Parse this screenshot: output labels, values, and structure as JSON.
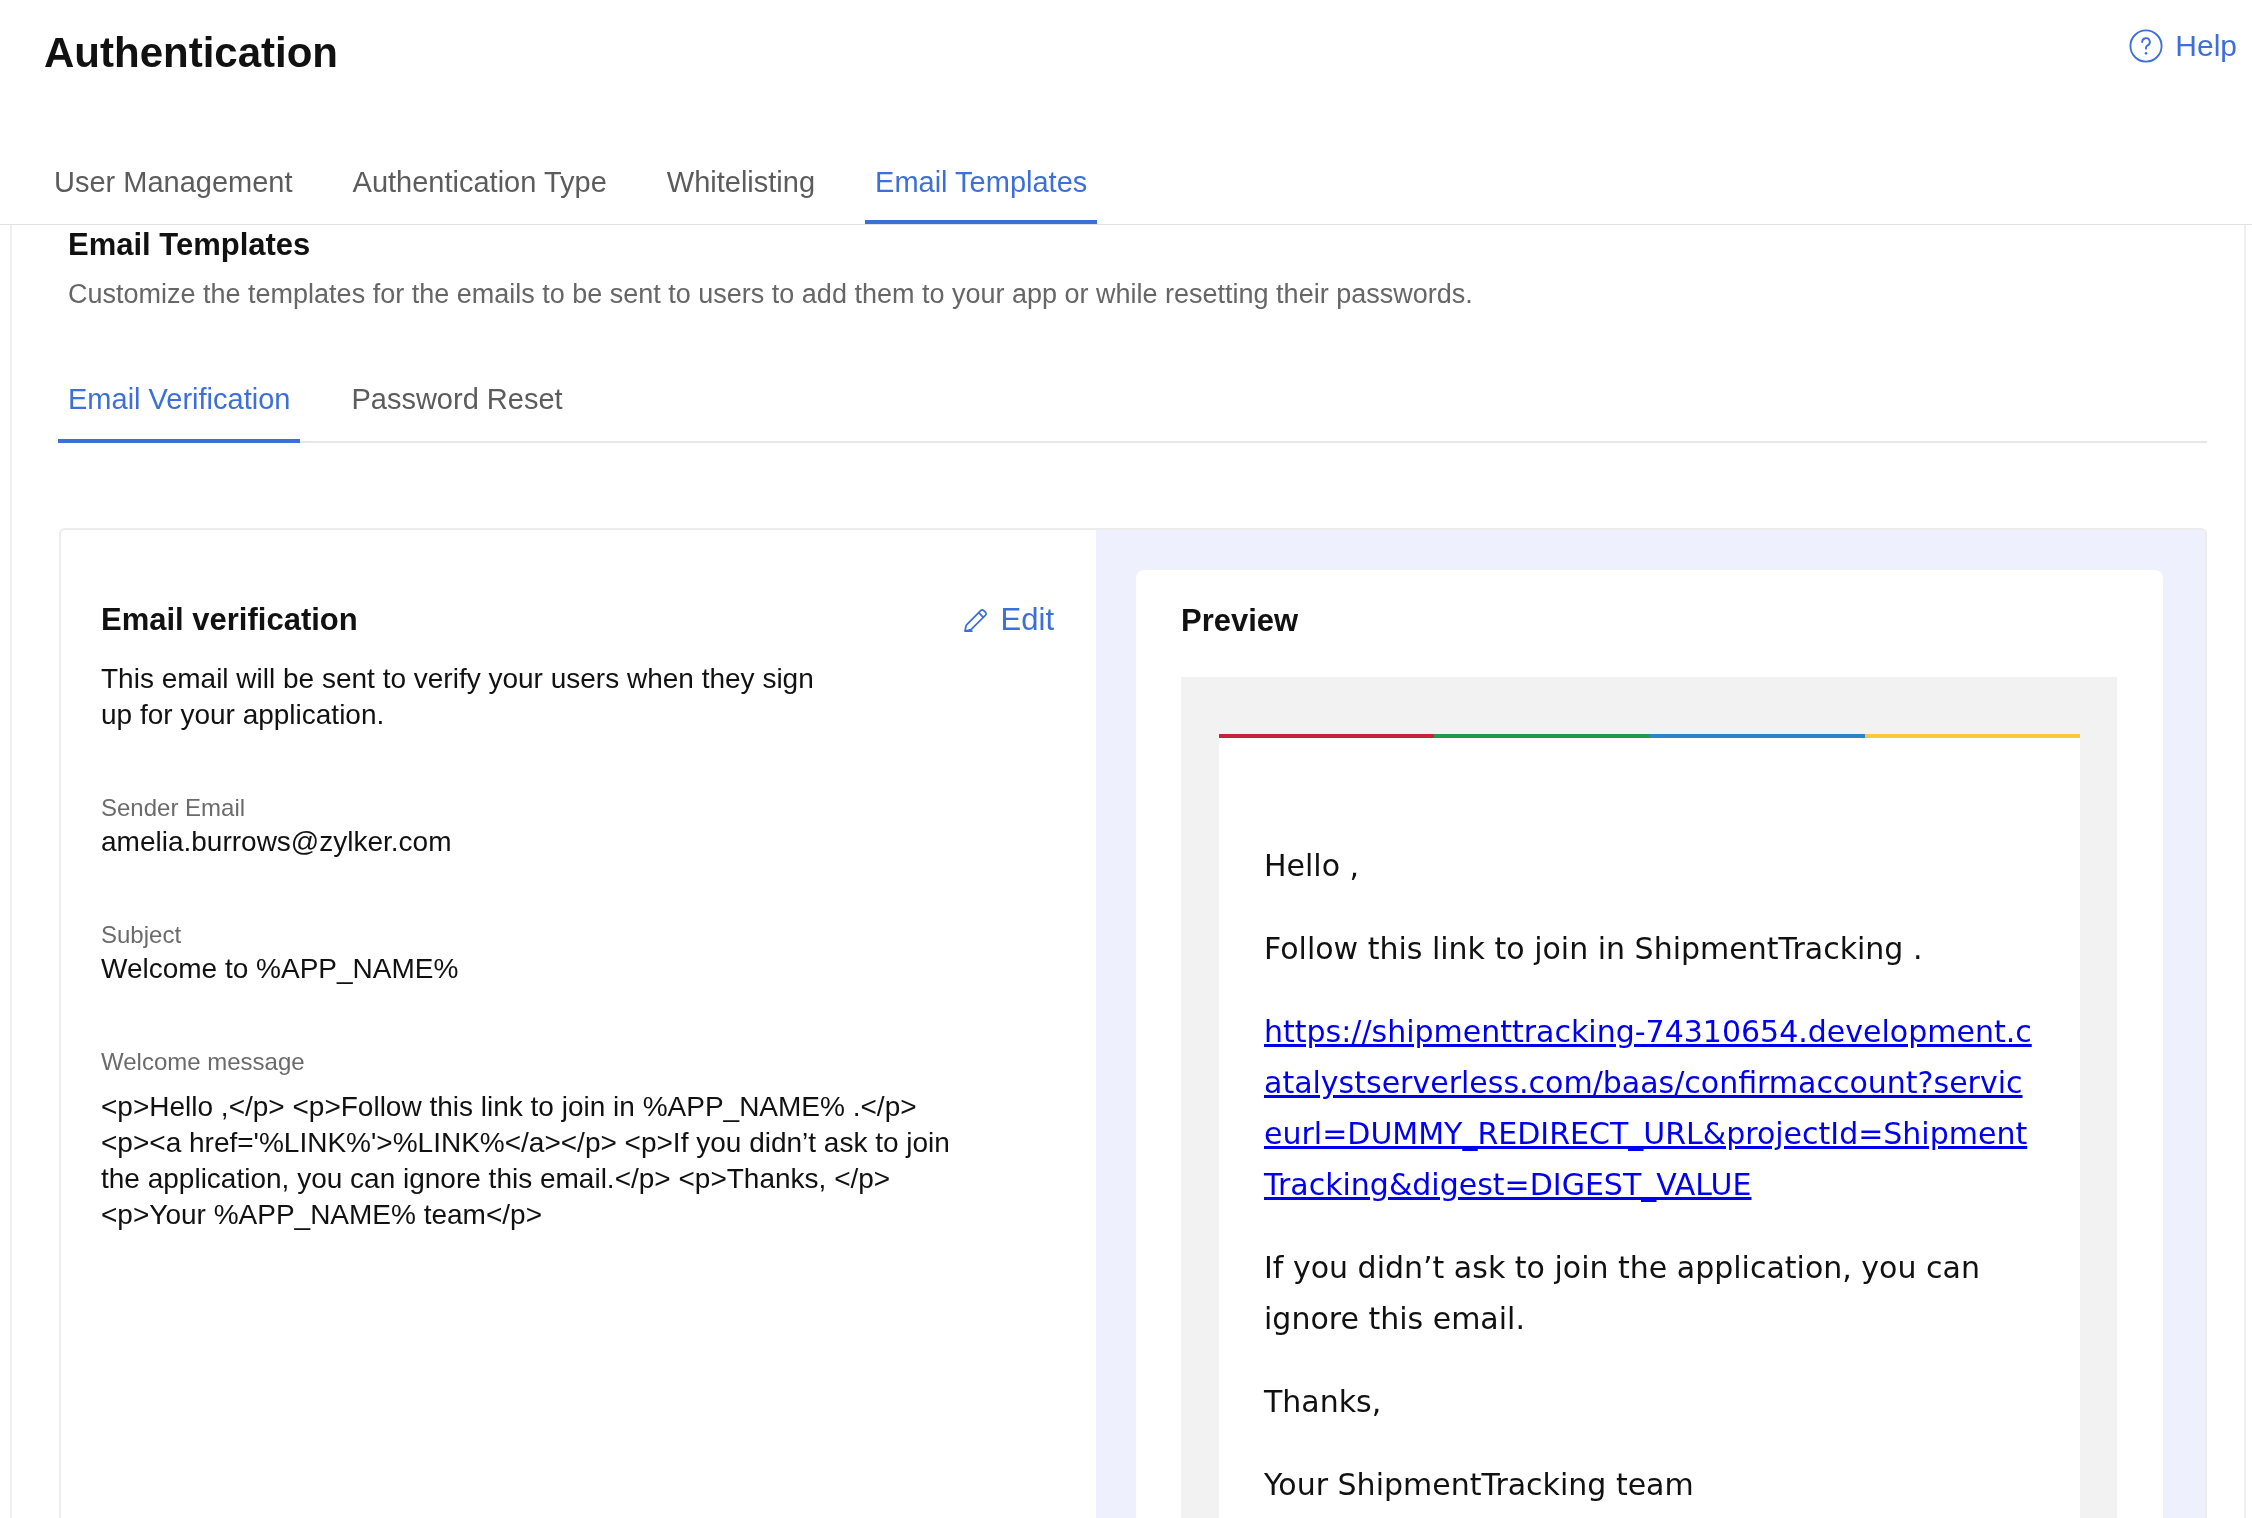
{
  "header": {
    "title": "Authentication",
    "help_link": "Help"
  },
  "tabs": [
    {
      "label": "User Management",
      "selected": false
    },
    {
      "label": "Authentication Type",
      "selected": false
    },
    {
      "label": "Whitelisting",
      "selected": false
    },
    {
      "label": "Email Templates",
      "selected": true
    }
  ],
  "section": {
    "title": "Email Templates",
    "description": "Customize the templates for the emails to be sent to users to add them to your app or while resetting their passwords."
  },
  "subtabs": [
    {
      "label": "Email Verification",
      "selected": true
    },
    {
      "label": "Password Reset",
      "selected": false
    }
  ],
  "template": {
    "title": "Email verification",
    "edit_link": "Edit",
    "description": "This email will be sent to verify your users when they sign up for your application.",
    "fields": [
      {
        "label": "Sender Email",
        "value": "amelia.burrows@zylker.com"
      },
      {
        "label": "Subject",
        "value": "Welcome to %APP_NAME%"
      },
      {
        "label": "Welcome message",
        "value": "<p>Hello ,</p> <p>Follow this link to join in %APP_NAME% .</p> <p><a href='%LINK%'>%LINK%</a></p> <p>If you didn’t ask to join the application, you can ignore this email.</p> <p>Thanks, </p> <p>Your %APP_NAME% team</p>"
      }
    ]
  },
  "preview": {
    "title": "Preview",
    "accent_stripe": [
      {
        "color": "#c8213a"
      },
      {
        "color": "#1e9a4c"
      },
      {
        "color": "#2a85c8"
      },
      {
        "color": "#f6ca3a"
      }
    ],
    "email": [
      {
        "kind": "text",
        "text": "Hello ,"
      },
      {
        "kind": "text",
        "text": "Follow this link to join in ShipmentTracking ."
      },
      {
        "kind": "link",
        "text": "https://shipmenttracking-74310654.development.catalystserverless.com/baas/confirmaccount?serviceurl=DUMMY_REDIRECT_URL&projectId=ShipmentTracking&digest=DIGEST_VALUE"
      },
      {
        "kind": "text",
        "text": "If you didn’t ask to join the application, you can ignore this email."
      },
      {
        "kind": "text",
        "text": "Thanks,"
      },
      {
        "kind": "text",
        "text": "Your ShipmentTracking team"
      }
    ]
  }
}
